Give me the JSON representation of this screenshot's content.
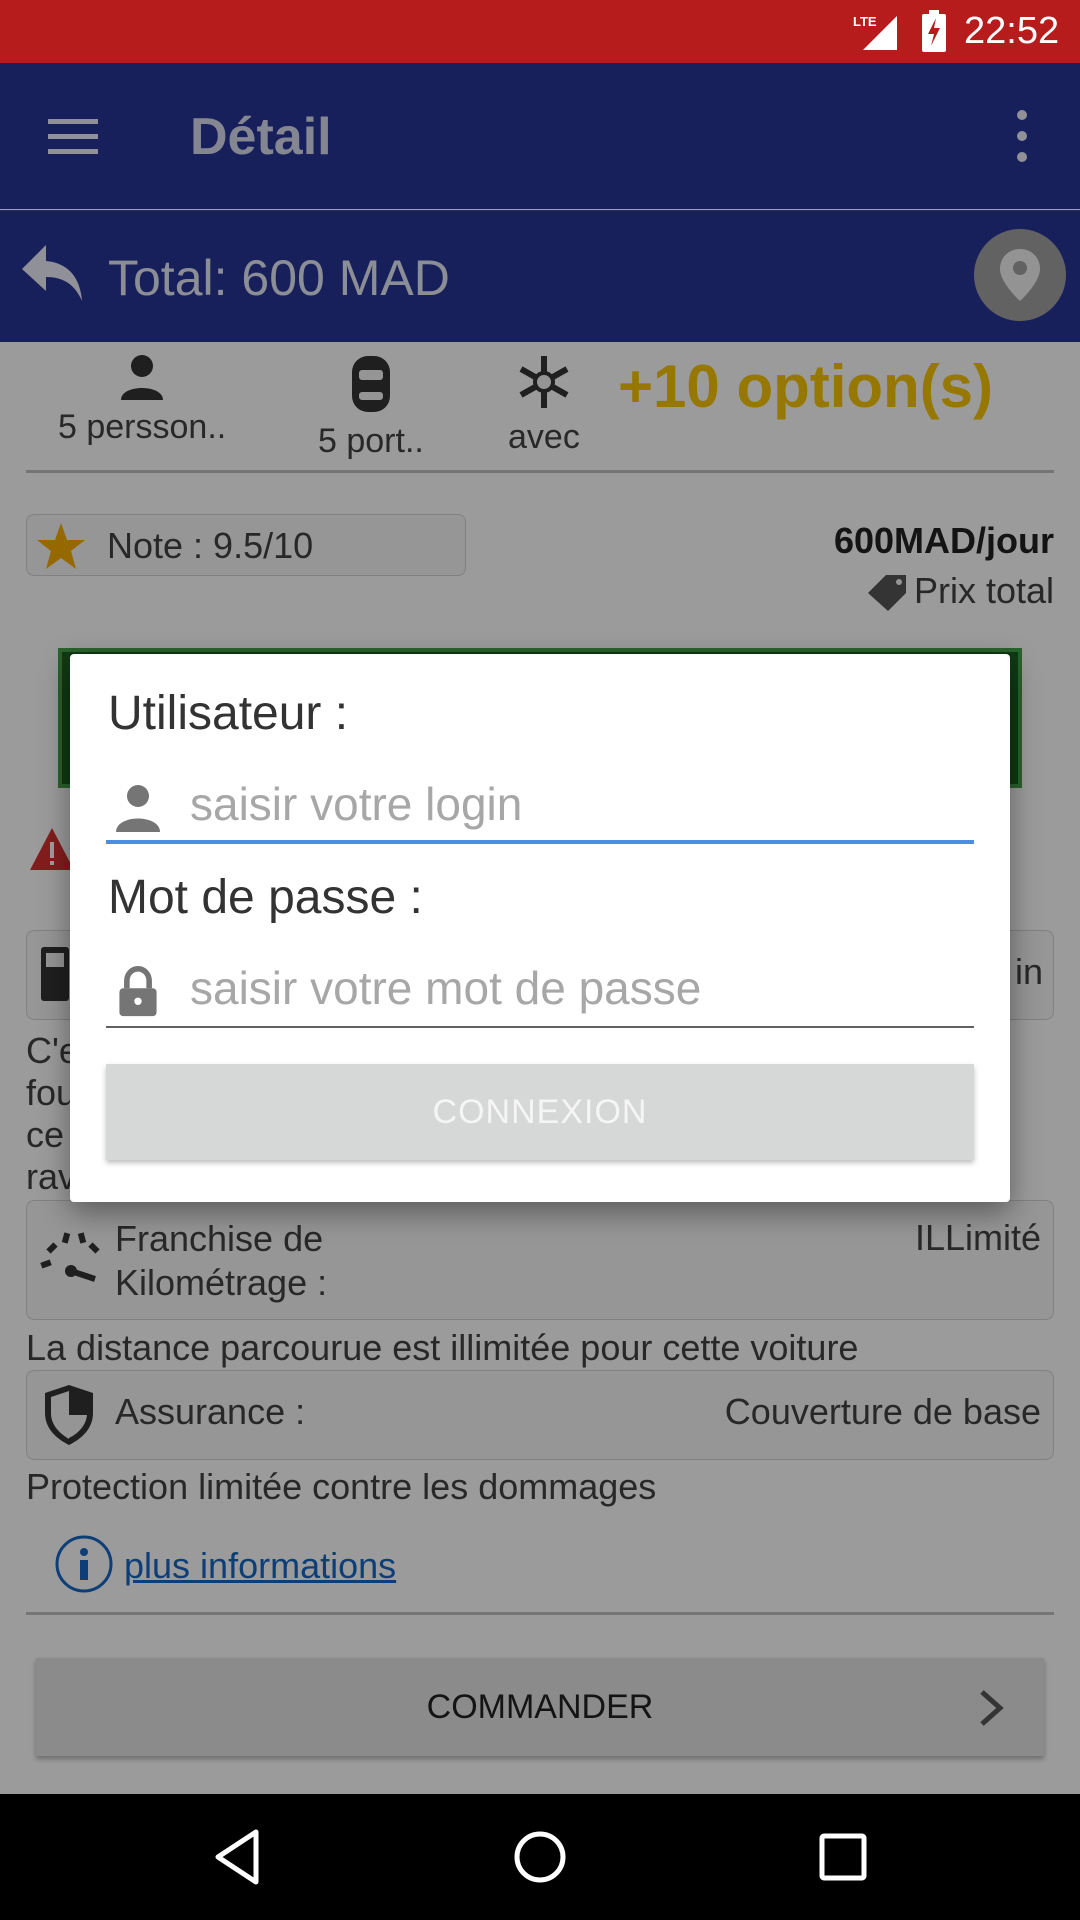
{
  "status_bar": {
    "time": "22:52",
    "network": "LTE"
  },
  "toolbar": {
    "title": "Détail"
  },
  "total_bar": {
    "total": "Total: 600 MAD"
  },
  "features": [
    {
      "icon": "person-icon",
      "label": "5 persson.."
    },
    {
      "icon": "car-door-icon",
      "label": "5 port.."
    },
    {
      "icon": "snowflake-icon",
      "label": "avec"
    }
  ],
  "options_label": "+10 option(s)",
  "note": "Note : 9.5/10",
  "price": {
    "per_day": "600MAD/jour",
    "total_label": "Prix total"
  },
  "fuel": {
    "value_partial": "in",
    "desc_fragments": [
      "C'e",
      "fou",
      "ce",
      "rav"
    ]
  },
  "mileage": {
    "label": "Franchise de Kilométrage :",
    "value": "ILLimité",
    "description": "La distance parcourue est illimitée pour cette voiture"
  },
  "insurance": {
    "label": "Assurance :",
    "value": "Couverture de base",
    "description": "Protection limitée contre les dommages"
  },
  "more_info": "plus informations",
  "order_button": "COMMANDER",
  "dialog": {
    "user_label": "Utilisateur :",
    "user_placeholder": "saisir votre login",
    "password_label": "Mot de passe :",
    "password_placeholder": "saisir votre mot de passe",
    "connect_button": "CONNEXION"
  },
  "colors": {
    "status_bar": "#b71c1c",
    "app_bar": "#283593",
    "options": "#f2c200",
    "focus_line": "#4a90e2",
    "link": "#1565c0"
  }
}
